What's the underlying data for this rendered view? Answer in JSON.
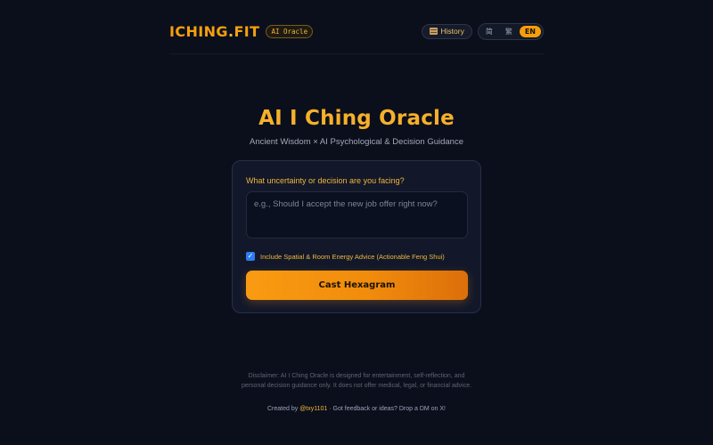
{
  "header": {
    "logo_text": "ICHING",
    "logo_dot": ".",
    "logo_tld": "FIT",
    "badge": "AI Oracle",
    "history_label": "History",
    "history_icon": "scroll-icon",
    "languages": [
      "简",
      "繁",
      "EN"
    ],
    "active_language": "EN"
  },
  "hero": {
    "title": "AI I Ching Oracle",
    "subtitle": "Ancient Wisdom × AI Psychological & Decision Guidance"
  },
  "form": {
    "question_label": "What uncertainty or decision are you facing?",
    "question_placeholder": "e.g., Should I accept the new job offer right now?",
    "question_value": "",
    "feng_shui_label": "Include Spatial & Room Energy Advice (Actionable Feng Shui)",
    "feng_shui_checked": true,
    "submit_label": "Cast Hexagram"
  },
  "footer": {
    "disclaimer": "Disclaimer: AI I Ching Oracle is designed for entertainment, self-reflection, and personal decision guidance only. It does not offer medical, legal, or financial advice.",
    "credit_prefix": "Created by",
    "credit_handle": "@txy1101",
    "credit_suffix": "· Got feedback or ideas? Drop a DM on X!"
  },
  "colors": {
    "background": "#0b0f1c",
    "accent": "#f59e0b",
    "card": "#12182a",
    "checkbox": "#2f7bf0"
  }
}
